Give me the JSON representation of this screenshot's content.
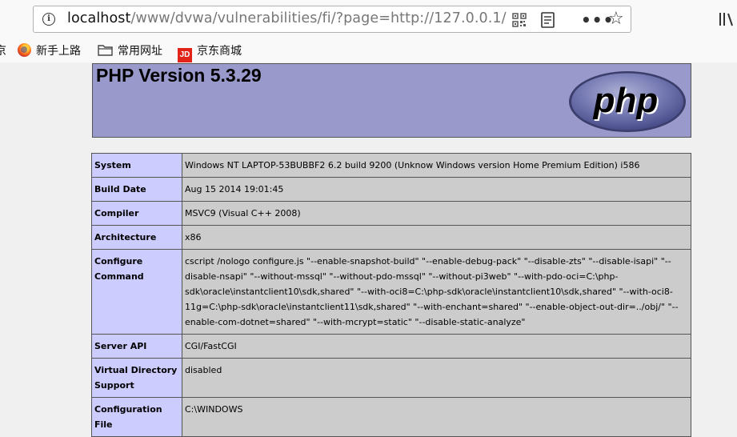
{
  "browser": {
    "url_host": "localhost",
    "url_path": "/www/dvwa/vulnerabilities/fi/?page=http://127.0.0.1/",
    "bookmarks": [
      {
        "label": "京",
        "icon": "cut-off-item"
      },
      {
        "label": "新手上路",
        "icon": "firefox-icon"
      },
      {
        "label": "常用网址",
        "icon": "folder-icon"
      },
      {
        "label": "京东商城",
        "icon": "jd-icon"
      }
    ],
    "jd_icon_text": "JD"
  },
  "phpinfo": {
    "title": "PHP Version 5.3.29",
    "logo_text": "php",
    "rows": [
      {
        "key": "System",
        "value": "Windows NT LAPTOP-53BUBBF2 6.2 build 9200 (Unknow Windows version Home Premium Edition) i586"
      },
      {
        "key": "Build Date",
        "value": "Aug 15 2014 19:01:45"
      },
      {
        "key": "Compiler",
        "value": "MSVC9 (Visual C++ 2008)"
      },
      {
        "key": "Architecture",
        "value": "x86"
      },
      {
        "key": "Configure Command",
        "value": "cscript /nologo configure.js \"--enable-snapshot-build\" \"--enable-debug-pack\" \"--disable-zts\" \"--disable-isapi\" \"--disable-nsapi\" \"--without-mssql\" \"--without-pdo-mssql\" \"--without-pi3web\" \"--with-pdo-oci=C:\\php-sdk\\oracle\\instantclient10\\sdk,shared\" \"--with-oci8=C:\\php-sdk\\oracle\\instantclient10\\sdk,shared\" \"--with-oci8-11g=C:\\php-sdk\\oracle\\instantclient11\\sdk,shared\" \"--with-enchant=shared\" \"--enable-object-out-dir=../obj/\" \"--enable-com-dotnet=shared\" \"--with-mcrypt=static\" \"--disable-static-analyze\""
      },
      {
        "key": "Server API",
        "value": "CGI/FastCGI"
      },
      {
        "key": "Virtual Directory Support",
        "value": "disabled"
      },
      {
        "key": "Configuration File",
        "value": "C:\\WINDOWS"
      }
    ]
  }
}
